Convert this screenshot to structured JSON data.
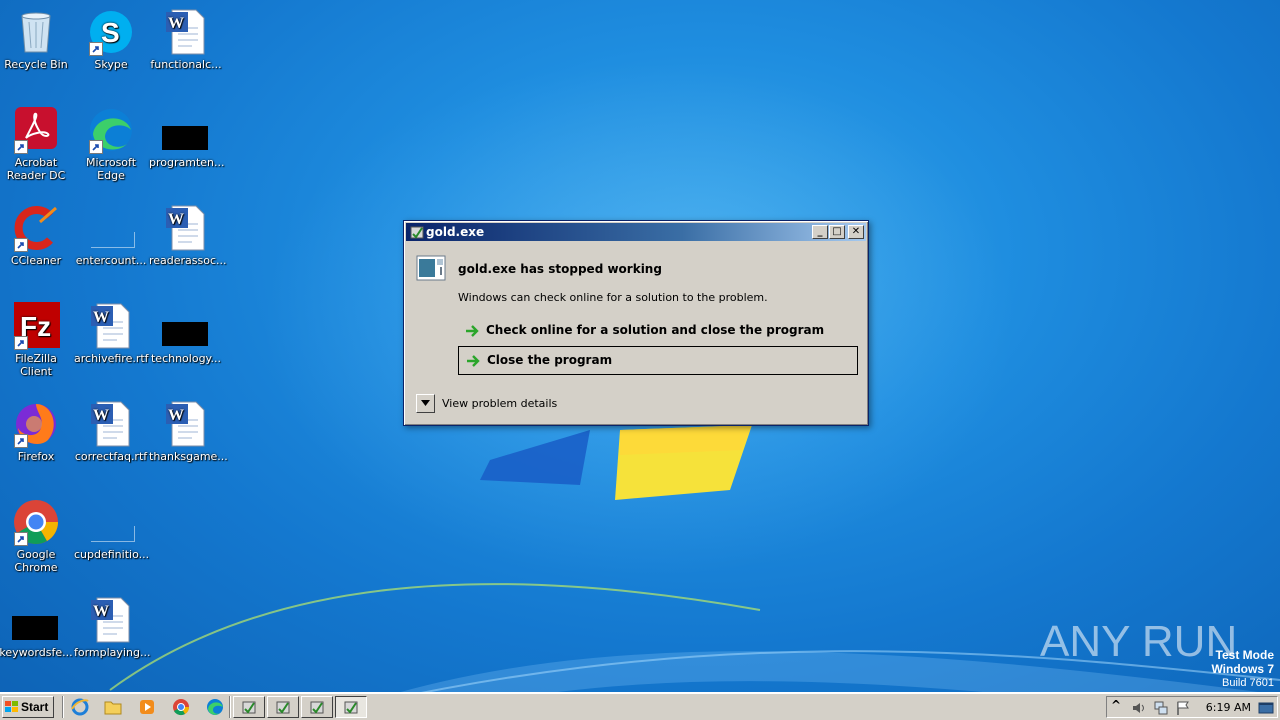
{
  "desktop": {
    "icons": [
      {
        "label": "Recycle Bin"
      },
      {
        "label": "Skype"
      },
      {
        "label": "functionalc..."
      },
      {
        "label": "Acrobat Reader DC"
      },
      {
        "label": "Microsoft Edge"
      },
      {
        "label": "programten..."
      },
      {
        "label": "CCleaner"
      },
      {
        "label": "entercount..."
      },
      {
        "label": "readerassoc..."
      },
      {
        "label": "FileZilla Client"
      },
      {
        "label": "archivefire.rtf"
      },
      {
        "label": "technology..."
      },
      {
        "label": "Firefox"
      },
      {
        "label": "correctfaq.rtf"
      },
      {
        "label": "thanksgame..."
      },
      {
        "label": "Google Chrome"
      },
      {
        "label": "cupdefinitio..."
      },
      {
        "label": "keywordsfe..."
      },
      {
        "label": "formplaying..."
      }
    ]
  },
  "dialog": {
    "title": "gold.exe",
    "heading": "gold.exe has stopped working",
    "message": "Windows can check online for a solution to the problem.",
    "option_check_online": "Check online for a solution and close the program",
    "option_close": "Close the program",
    "details_label": "View problem details",
    "minimize_glyph": "_",
    "maximize_glyph": "□",
    "close_glyph": "✕"
  },
  "watermark": {
    "brand": "ANY RUN",
    "mode": "Test Mode",
    "os": "Windows 7",
    "build": "Build 7601"
  },
  "taskbar": {
    "start_label": "Start",
    "clock": "6:19 AM",
    "tray_chevron": "^"
  },
  "colors": {
    "title_gradient_start": "#0a246a",
    "title_gradient_end": "#a6caf0",
    "dialog_face": "#d4d0c8",
    "desktop_blue": "#1478cf",
    "arrow_green": "#2aa52a"
  }
}
